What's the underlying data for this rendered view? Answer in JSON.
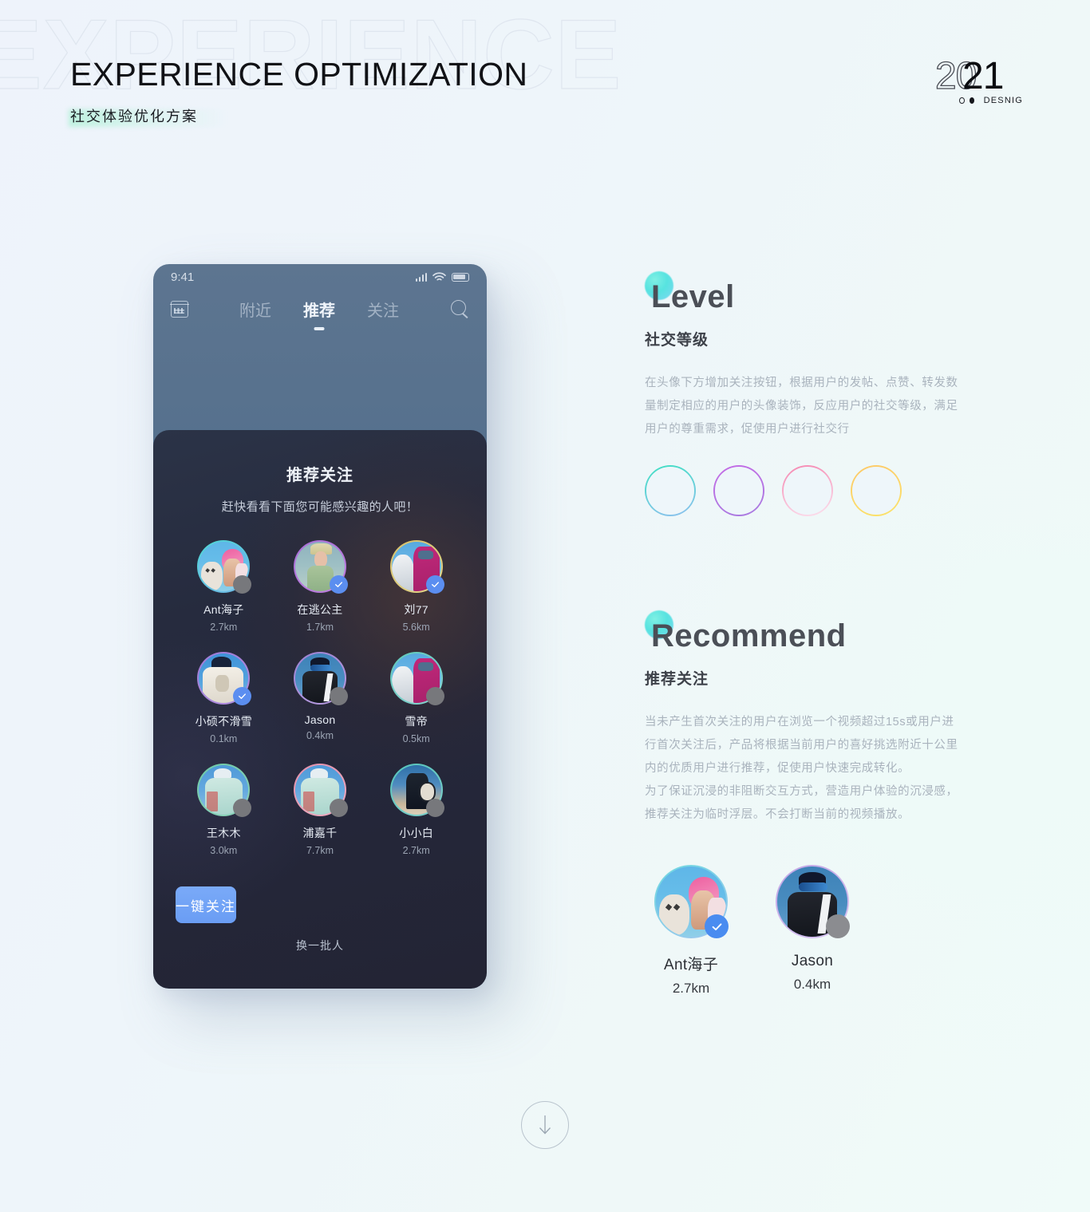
{
  "header": {
    "watermark": "EXPERIENCE",
    "title": "EXPERIENCE OPTIMIZATION",
    "subtitle": "社交体验优化方案"
  },
  "logo": {
    "year_outline": "20",
    "year_solid": "21",
    "brand": "DESNIG"
  },
  "phone": {
    "status": {
      "time": "9:41"
    },
    "nav": {
      "calendar_icon": "calendar-icon",
      "search_icon": "search-icon",
      "tabs": [
        {
          "label": "附近",
          "active": false
        },
        {
          "label": "推荐",
          "active": true
        },
        {
          "label": "关注",
          "active": false
        }
      ]
    },
    "modal": {
      "title": "推荐关注",
      "subtitle": "赶快看看下面您可能感兴趣的人吧！",
      "people": [
        {
          "name": "Ant海子",
          "distance": "2.7km",
          "followed": false,
          "ring": "#4fd6d4",
          "ring2": "#6fb7e8",
          "scene": "pinkhat"
        },
        {
          "name": "在逃公主",
          "distance": "1.7km",
          "followed": true,
          "ring": "#a86fd8",
          "ring2": "#c07de0",
          "scene": "green"
        },
        {
          "name": "刘77",
          "distance": "5.6km",
          "followed": true,
          "ring": "#d8c06a",
          "ring2": "#e3d486",
          "scene": "magenta"
        },
        {
          "name": "小硕不滑雪",
          "distance": "0.1km",
          "followed": true,
          "ring": "#9d7ad6",
          "ring2": "#b48ee0",
          "scene": "white"
        },
        {
          "name": "Jason",
          "distance": "0.4km",
          "followed": false,
          "ring": "#9d82d2",
          "ring2": "#b99ce0",
          "scene": "black"
        },
        {
          "name": "雪帝",
          "distance": "0.5km",
          "followed": false,
          "ring": "#5fc9bb",
          "ring2": "#87d4cf",
          "scene": "magenta"
        },
        {
          "name": "王木木",
          "distance": "3.0km",
          "followed": false,
          "ring": "#6dc9a6",
          "ring2": "#8fd4bb",
          "scene": "mint"
        },
        {
          "name": "浦嘉千",
          "distance": "7.7km",
          "followed": false,
          "ring": "#e390ab",
          "ring2": "#efacc0",
          "scene": "mint"
        },
        {
          "name": "小小白",
          "distance": "2.7km",
          "followed": false,
          "ring": "#55c4bb",
          "ring2": "#7fd0cb",
          "scene": "dusk"
        }
      ],
      "primary_button": "一键关注",
      "secondary_link": "换一批人"
    }
  },
  "sections": [
    {
      "en": "Level",
      "cn": "社交等级",
      "body": "在头像下方增加关注按钮，根据用户的发帖、点赞、转发数量制定相应的用户的头像装饰，反应用户的社交等级，满足用户的尊重需求，促使用户进行社交行",
      "rings": [
        {
          "from": "#3fe0c3",
          "to": "#8fc0ef"
        },
        {
          "from": "#c46be6",
          "to": "#a87be0"
        },
        {
          "from": "#f586b0",
          "to": "#fbe3ef"
        },
        {
          "from": "#fdc968",
          "to": "#fbe36a"
        }
      ]
    },
    {
      "en": "Recommend",
      "cn": "推荐关注",
      "body": "当未产生首次关注的用户在浏览一个视频超过15s或用户进行首次关注后，产品将根据当前用户的喜好挑选附近十公里内的优质用户进行推荐，促使用户快速完成转化。\n为了保证沉浸的非阻断交互方式，营造用户体验的沉浸感，推荐关注为临时浮层。不会打断当前的视频播放。",
      "people": [
        {
          "name": "Ant海子",
          "distance": "2.7km",
          "followed": true,
          "ring": "#6fd9e0",
          "ring2": "#9ec6ef",
          "scene": "pinkhat"
        },
        {
          "name": "Jason",
          "distance": "0.4km",
          "followed": false,
          "ring": "#c0a5e6",
          "ring2": "#d8c2f0",
          "scene": "black"
        }
      ]
    }
  ],
  "scroll_indicator": {
    "icon": "arrow-down-icon"
  }
}
